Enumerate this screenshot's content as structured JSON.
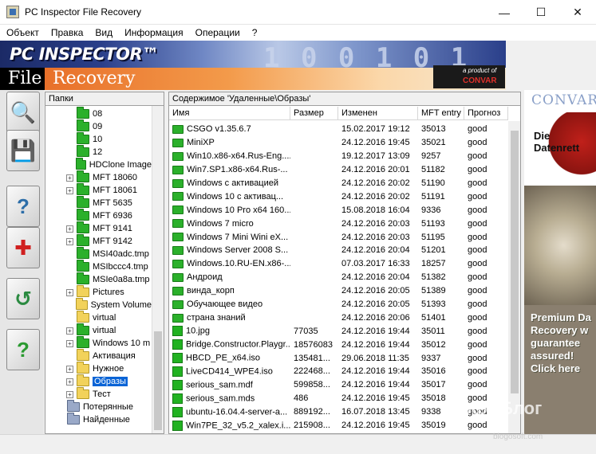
{
  "window": {
    "title": "PC Inspector File Recovery",
    "minimize": "—",
    "maximize": "☐",
    "close": "✕"
  },
  "menu": [
    "Объект",
    "Правка",
    "Вид",
    "Информация",
    "Операции",
    "?"
  ],
  "banner": {
    "brand": "PC INSPECTOR™",
    "digits": "1  0 0 1 0 1",
    "file_word": "File",
    "recovery_word": "Recovery",
    "product_of": "a product of",
    "convar": "CONVAR"
  },
  "folders_panel": {
    "header": "Папки",
    "items": [
      {
        "label": "08",
        "color": "green",
        "expander": ""
      },
      {
        "label": "09",
        "color": "green",
        "expander": ""
      },
      {
        "label": "10",
        "color": "green",
        "expander": ""
      },
      {
        "label": "12",
        "color": "green",
        "expander": ""
      },
      {
        "label": "HDClone Image",
        "color": "green",
        "expander": ""
      },
      {
        "label": "MFT 18060",
        "color": "green",
        "expander": "+"
      },
      {
        "label": "MFT 18061",
        "color": "green",
        "expander": "+"
      },
      {
        "label": "MFT 5635",
        "color": "green",
        "expander": ""
      },
      {
        "label": "MFT 6936",
        "color": "green",
        "expander": ""
      },
      {
        "label": "MFT 9141",
        "color": "green",
        "expander": "+"
      },
      {
        "label": "MFT 9142",
        "color": "green",
        "expander": "+"
      },
      {
        "label": "MSI40adc.tmp",
        "color": "green",
        "expander": ""
      },
      {
        "label": "MSIbccc4.tmp",
        "color": "green",
        "expander": ""
      },
      {
        "label": "MSIe0a8a.tmp",
        "color": "green",
        "expander": ""
      },
      {
        "label": "Pictures",
        "color": "yellow",
        "expander": "+"
      },
      {
        "label": "System Volume",
        "color": "yellow",
        "expander": ""
      },
      {
        "label": "virtual",
        "color": "yellow",
        "expander": ""
      },
      {
        "label": "virtual",
        "color": "green",
        "expander": "+"
      },
      {
        "label": "Windows 10 m",
        "color": "green",
        "expander": "+"
      },
      {
        "label": "Активация",
        "color": "yellow",
        "expander": ""
      },
      {
        "label": "Нужное",
        "color": "yellow",
        "expander": "+"
      },
      {
        "label": "Образы",
        "color": "yellow",
        "expander": "+",
        "selected": true
      },
      {
        "label": "Тест",
        "color": "yellow",
        "expander": "+"
      },
      {
        "label": "Потерянные",
        "color": "root",
        "expander": ""
      },
      {
        "label": "Найденные",
        "color": "root",
        "expander": ""
      }
    ]
  },
  "files_panel": {
    "header": "Содержимое 'Удаленные\\Образы'",
    "columns": [
      "Имя",
      "Размер",
      "Изменен",
      "MFT entry",
      "Прогноз"
    ],
    "rows": [
      {
        "name": "CSGO v1.35.6.7",
        "type": "folder",
        "size": "",
        "modified": "15.02.2017 19:12",
        "mft": "35013",
        "forecast": "good"
      },
      {
        "name": "MiniXP",
        "type": "folder",
        "size": "",
        "modified": "24.12.2016 19:45",
        "mft": "35021",
        "forecast": "good"
      },
      {
        "name": "Win10.x86-x64.Rus-Eng....",
        "type": "folder",
        "size": "",
        "modified": "19.12.2017 13:09",
        "mft": "9257",
        "forecast": "good"
      },
      {
        "name": "Win7.SP1.x86-x64.Rus-...",
        "type": "folder",
        "size": "",
        "modified": "24.12.2016 20:01",
        "mft": "51182",
        "forecast": "good"
      },
      {
        "name": "Windows  с активацией",
        "type": "folder",
        "size": "",
        "modified": "24.12.2016 20:02",
        "mft": "51190",
        "forecast": "good"
      },
      {
        "name": "Windows 10  с активац...",
        "type": "folder",
        "size": "",
        "modified": "24.12.2016 20:02",
        "mft": "51191",
        "forecast": "good"
      },
      {
        "name": "Windows 10 Pro x64 160...",
        "type": "folder",
        "size": "",
        "modified": "15.08.2018 16:04",
        "mft": "9336",
        "forecast": "good"
      },
      {
        "name": "Windows 7 micro",
        "type": "folder",
        "size": "",
        "modified": "24.12.2016 20:03",
        "mft": "51193",
        "forecast": "good"
      },
      {
        "name": "Windows 7 Mini Wini eX...",
        "type": "folder",
        "size": "",
        "modified": "24.12.2016 20:03",
        "mft": "51195",
        "forecast": "good"
      },
      {
        "name": "Windows Server 2008 S...",
        "type": "folder",
        "size": "",
        "modified": "24.12.2016 20:04",
        "mft": "51201",
        "forecast": "good"
      },
      {
        "name": "Windows.10.RU-EN.x86-...",
        "type": "folder",
        "size": "",
        "modified": "07.03.2017 16:33",
        "mft": "18257",
        "forecast": "good"
      },
      {
        "name": "Андроид",
        "type": "folder",
        "size": "",
        "modified": "24.12.2016 20:04",
        "mft": "51382",
        "forecast": "good"
      },
      {
        "name": "винда_корп",
        "type": "folder",
        "size": "",
        "modified": "24.12.2016 20:05",
        "mft": "51389",
        "forecast": "good"
      },
      {
        "name": "Обучающее видео",
        "type": "folder",
        "size": "",
        "modified": "24.12.2016 20:05",
        "mft": "51393",
        "forecast": "good"
      },
      {
        "name": "страна знаний",
        "type": "folder",
        "size": "",
        "modified": "24.12.2016 20:06",
        "mft": "51401",
        "forecast": "good"
      },
      {
        "name": "10.jpg",
        "type": "file",
        "size": "77035",
        "modified": "24.12.2016 19:44",
        "mft": "35011",
        "forecast": "good"
      },
      {
        "name": "Bridge.Constructor.Playgr...",
        "type": "file",
        "size": "18576083",
        "modified": "24.12.2016 19:44",
        "mft": "35012",
        "forecast": "good"
      },
      {
        "name": "HBCD_PE_x64.iso",
        "type": "file",
        "size": "135481...",
        "modified": "29.06.2018 11:35",
        "mft": "9337",
        "forecast": "good"
      },
      {
        "name": "LiveCD414_WPE4.iso",
        "type": "file",
        "size": "222468...",
        "modified": "24.12.2016 19:44",
        "mft": "35016",
        "forecast": "good"
      },
      {
        "name": "serious_sam.mdf",
        "type": "file",
        "size": "599858...",
        "modified": "24.12.2016 19:44",
        "mft": "35017",
        "forecast": "good"
      },
      {
        "name": "serious_sam.mds",
        "type": "file",
        "size": "486",
        "modified": "24.12.2016 19:45",
        "mft": "35018",
        "forecast": "good"
      },
      {
        "name": "ubuntu-16.04.4-server-a...",
        "type": "file",
        "size": "889192...",
        "modified": "16.07.2018 13:45",
        "mft": "9338",
        "forecast": "good"
      },
      {
        "name": "Win7PE_32_v5.2_xalex.i...",
        "type": "file",
        "size": "215908...",
        "modified": "24.12.2016 19:45",
        "mft": "35019",
        "forecast": "good"
      }
    ]
  },
  "ad": {
    "brand": "CONVAR",
    "die": "Die Datenrett",
    "premium": "Premium Da Recovery w guarantee assured! Click here"
  },
  "watermark": {
    "main": "Софт Блог",
    "sub": "blogosoft.com"
  }
}
